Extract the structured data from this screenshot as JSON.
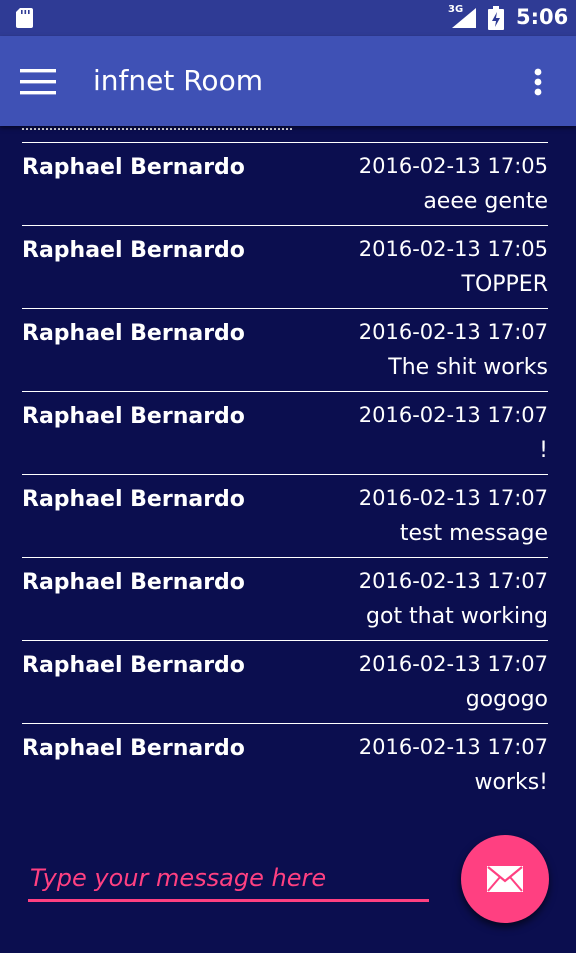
{
  "status_bar": {
    "network": "3G",
    "time": "5:06"
  },
  "app_bar": {
    "title": "infnet Room"
  },
  "messages": [
    {
      "author": "Raphael Bernardo",
      "timestamp": "2016-02-13 17:05",
      "text": "aeee gente"
    },
    {
      "author": "Raphael Bernardo",
      "timestamp": "2016-02-13 17:05",
      "text": "TOPPER"
    },
    {
      "author": "Raphael Bernardo",
      "timestamp": "2016-02-13 17:07",
      "text": "The shit works"
    },
    {
      "author": "Raphael Bernardo",
      "timestamp": "2016-02-13 17:07",
      "text": "!"
    },
    {
      "author": "Raphael Bernardo",
      "timestamp": "2016-02-13 17:07",
      "text": "test message"
    },
    {
      "author": "Raphael Bernardo",
      "timestamp": "2016-02-13 17:07",
      "text": "got that working"
    },
    {
      "author": "Raphael Bernardo",
      "timestamp": "2016-02-13 17:07",
      "text": "gogogo"
    },
    {
      "author": "Raphael Bernardo",
      "timestamp": "2016-02-13 17:07",
      "text": "works!"
    }
  ],
  "compose": {
    "placeholder": "Type your message here",
    "value": ""
  },
  "icons": {
    "menu": "hamburger-menu-icon",
    "overflow": "more-vert-icon",
    "send": "envelope-icon",
    "sd_card": "sd-card-icon",
    "signal": "signal-icon",
    "battery": "battery-charging-icon"
  },
  "colors": {
    "background": "#0b0e4f",
    "app_bar": "#3f51b5",
    "status_bar": "#2f3b95",
    "accent": "#ff4081",
    "text": "#ffffff"
  }
}
